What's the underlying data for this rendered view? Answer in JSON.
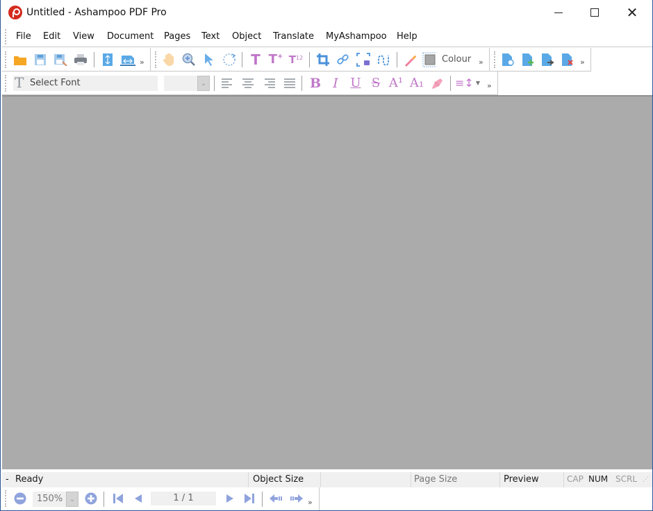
{
  "window": {
    "title": "Untitled - Ashampoo PDF Pro",
    "controls": {
      "minimize": "minimize",
      "maximize": "maximize",
      "close": "close"
    }
  },
  "menubar": {
    "items": [
      "File",
      "Edit",
      "View",
      "Document",
      "Pages",
      "Text",
      "Object",
      "Translate",
      "MyAshampoo",
      "Help"
    ]
  },
  "toolbar1": {
    "file_group": [
      {
        "name": "open-folder-icon",
        "glyph": "📂",
        "color": "#f5a623"
      },
      {
        "name": "save-icon",
        "glyph": "💾",
        "color": "#7ab0dd"
      },
      {
        "name": "save-as-icon",
        "glyph": "🖫",
        "color": "#7ab0dd"
      },
      {
        "name": "print-icon",
        "glyph": "🖶",
        "color": "#7a8089"
      },
      {
        "name": "fit-height-icon",
        "glyph": "⇕",
        "color": "#5aa9e6"
      },
      {
        "name": "fit-width-icon",
        "glyph": "⇔",
        "color": "#5aa9e6"
      }
    ],
    "tools_group": [
      {
        "name": "hand-tool-icon",
        "glyph": "✋",
        "color": "#f7c98c"
      },
      {
        "name": "zoom-tool-icon",
        "glyph": "🔍",
        "color": "#7aa5d8"
      },
      {
        "name": "select-arrow-icon",
        "glyph": "➤",
        "color": "#6aaee9"
      },
      {
        "name": "rotate-icon",
        "glyph": "↻",
        "color": "#8fb8e0"
      },
      {
        "name": "text-tool-icon",
        "glyph": "T",
        "color": "#c077c8"
      },
      {
        "name": "add-text-icon",
        "glyph": "T+",
        "color": "#c077c8"
      },
      {
        "name": "text-numbering-icon",
        "glyph": "¹²T",
        "color": "#c077c8"
      },
      {
        "name": "crop-icon",
        "glyph": "⌗",
        "color": "#4a90d9"
      },
      {
        "name": "link-icon",
        "glyph": "🔗",
        "color": "#5a9ee0"
      },
      {
        "name": "snapshot-icon",
        "glyph": "⛶",
        "color": "#7b6fd0"
      },
      {
        "name": "path-icon",
        "glyph": "∿",
        "color": "#5a9ee0"
      },
      {
        "name": "color-picker-icon",
        "glyph": "🖉",
        "color": "#e86a7d"
      },
      {
        "name": "colour-swatch-icon",
        "glyph": "■",
        "color": "#9e9e9e"
      }
    ],
    "colour_label": "Colour",
    "pages_group": [
      {
        "name": "rotate-page-icon",
        "glyph": "↻",
        "color": "#5aa9e6"
      },
      {
        "name": "insert-page-icon",
        "glyph": "+",
        "color": "#5cb85c"
      },
      {
        "name": "extract-page-icon",
        "glyph": "➜",
        "color": "#555555"
      },
      {
        "name": "delete-page-icon",
        "glyph": "✕",
        "color": "#e04848"
      }
    ],
    "overflow": "»"
  },
  "toolbar2": {
    "font_select": {
      "placeholder": "Select Font",
      "value": ""
    },
    "font_size": {
      "value": ""
    },
    "align": [
      "align-left",
      "align-center",
      "align-right",
      "align-justify"
    ],
    "format": [
      {
        "name": "bold-icon",
        "glyph": "B"
      },
      {
        "name": "italic-icon",
        "glyph": "I"
      },
      {
        "name": "underline-icon",
        "glyph": "U"
      },
      {
        "name": "strikethrough-icon",
        "glyph": "S"
      },
      {
        "name": "superscript-icon",
        "glyph": "A¹"
      },
      {
        "name": "subscript-icon",
        "glyph": "A₁"
      },
      {
        "name": "highlighter-icon",
        "glyph": "▰"
      }
    ],
    "line_spacing": "≡↕",
    "overflow": "»",
    "accent": "#c77fd0"
  },
  "statusbar": {
    "indicator": "-",
    "status": "Ready",
    "object_size": "Object Size",
    "page_size": "Page Size",
    "preview": "Preview",
    "cap": "CAP",
    "num": "NUM",
    "scrl": "SCRL"
  },
  "navbar": {
    "zoom_value": "150%",
    "page_indicator": "1 / 1",
    "overflow": "»"
  },
  "colors": {
    "document_background": "#ababab",
    "nav_icon": "#8fa3dd",
    "text_accent": "#c077c8"
  }
}
